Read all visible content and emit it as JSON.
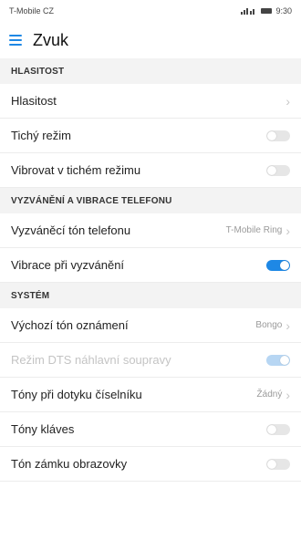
{
  "status": {
    "carrier": "T-Mobile CZ",
    "time": "9:30"
  },
  "header": {
    "title": "Zvuk"
  },
  "sections": [
    {
      "title": "HLASITOST"
    },
    {
      "title": "VYZVÁNĚNÍ A VIBRACE TELEFONU"
    },
    {
      "title": "SYSTÉM"
    }
  ],
  "rows": [
    {
      "label": "Hlasitost"
    },
    {
      "label": "Tichý režim",
      "toggle": "off"
    },
    {
      "label": "Vibrovat v tichém režimu",
      "toggle": "off"
    },
    {
      "label": "Vyzváněcí tón telefonu",
      "value": "T-Mobile Ring"
    },
    {
      "label": "Vibrace při vyzvánění",
      "toggle": "on"
    },
    {
      "label": "Výchozí tón oznámení",
      "value": "Bongo"
    },
    {
      "label": "Režim DTS náhlavní soupravy",
      "toggle": "on",
      "disabled": true
    },
    {
      "label": "Tóny při dotyku číselníku",
      "value": "Žádný"
    },
    {
      "label": "Tóny kláves",
      "toggle": "off"
    },
    {
      "label": "Tón zámku obrazovky",
      "toggle": "off"
    }
  ],
  "colors": {
    "accent": "#1e88e5"
  }
}
